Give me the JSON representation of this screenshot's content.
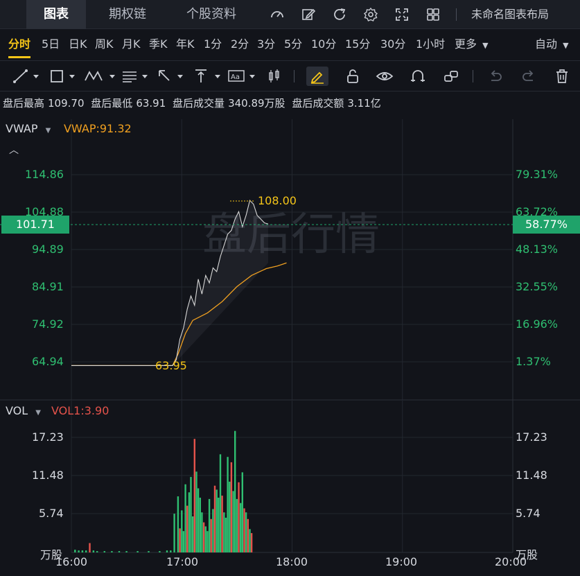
{
  "tabs": [
    "图表",
    "期权链",
    "个股资料"
  ],
  "layout_name": "未命名图表布局",
  "icons": [
    "gauge-icon",
    "edit-icon",
    "refresh-icon",
    "gear-icon",
    "fullscreen-icon",
    "grid-icon"
  ],
  "periods": [
    "分时",
    "5日",
    "日K",
    "周K",
    "月K",
    "季K",
    "年K",
    "1分",
    "2分",
    "3分",
    "5分",
    "10分",
    "15分",
    "30分",
    "1小时",
    "更多"
  ],
  "auto_label": "自动",
  "info": [
    {
      "label": "盘后最高",
      "value": "109.70"
    },
    {
      "label": "盘后最低",
      "value": "63.91"
    },
    {
      "label": "盘后成交量",
      "value": "340.89万股"
    },
    {
      "label": "盘后成交额",
      "value": "3.11亿"
    }
  ],
  "price_panel": {
    "indicator": "VWAP",
    "indicator_value": "VWAP:91.32",
    "watermark": "盘后行情",
    "y_left": [
      "114.86",
      "104.88",
      "94.89",
      "84.91",
      "74.92",
      "64.94"
    ],
    "y_right": [
      "79.31%",
      "63.72%",
      "48.13%",
      "32.55%",
      "16.96%",
      "1.37%"
    ],
    "current_price": "101.71",
    "current_pct": "58.77%",
    "high_label": "108.00",
    "low_label": "63.95"
  },
  "vol_panel": {
    "indicator": "VOL",
    "indicator_value": "VOL1:3.90",
    "y_left": [
      "17.23",
      "11.48",
      "5.74",
      "万股"
    ],
    "y_right": [
      "17.23",
      "11.48",
      "5.74",
      "万股"
    ]
  },
  "x_labels": [
    "16:00",
    "17:00",
    "18:00",
    "19:00",
    "20:00"
  ],
  "colors": {
    "up": "#2fbf71",
    "down": "#e5534b",
    "vwap": "#f0a020",
    "price": "#d8d8d8",
    "accent": "#f5c518"
  },
  "chart_data": {
    "type": "line",
    "x_range": [
      "16:00",
      "20:00"
    ],
    "ylim": [
      59.95,
      119.85
    ],
    "series": [
      {
        "name": "VWAP",
        "values": [
          [
            0,
            63.95
          ],
          [
            55,
            63.95
          ],
          [
            58,
            67.0
          ],
          [
            62,
            72.5
          ],
          [
            66,
            76.0
          ],
          [
            74,
            78.0
          ],
          [
            82,
            81.0
          ],
          [
            90,
            85.0
          ],
          [
            98,
            88.0
          ],
          [
            106,
            89.8
          ],
          [
            112,
            90.5
          ],
          [
            117,
            91.32
          ]
        ]
      },
      {
        "price_values": [
          [
            0,
            63.95
          ],
          [
            55,
            63.95
          ],
          [
            57,
            65.5
          ],
          [
            59,
            71.0
          ],
          [
            61,
            74.0
          ],
          [
            63,
            79.0
          ],
          [
            65,
            82.5
          ],
          [
            67,
            80.0
          ],
          [
            69,
            87.0
          ],
          [
            71,
            83.0
          ],
          [
            73,
            88.0
          ],
          [
            75,
            86.0
          ],
          [
            77,
            90.0
          ],
          [
            79,
            89.0
          ],
          [
            81,
            93.0
          ],
          [
            83,
            96.0
          ],
          [
            85,
            99.0
          ],
          [
            87,
            100.0
          ],
          [
            89,
            103.0
          ],
          [
            91,
            105.0
          ],
          [
            93,
            101.0
          ],
          [
            95,
            104.0
          ],
          [
            97,
            108.0
          ],
          [
            99,
            107.0
          ],
          [
            101,
            104.0
          ],
          [
            103,
            103.0
          ],
          [
            105,
            102.0
          ],
          [
            107,
            101.71
          ]
        ]
      }
    ],
    "volume": [
      [
        2,
        0.4
      ],
      [
        4,
        0.3
      ],
      [
        6,
        0.3
      ],
      [
        8,
        0.3
      ],
      [
        10,
        1.4
      ],
      [
        12,
        0.3
      ],
      [
        14,
        0.2
      ],
      [
        18,
        0.2
      ],
      [
        22,
        0.2
      ],
      [
        26,
        0.2
      ],
      [
        30,
        0.2
      ],
      [
        36,
        0.2
      ],
      [
        42,
        0.2
      ],
      [
        48,
        0.2
      ],
      [
        52,
        0.3
      ],
      [
        54,
        0.3
      ],
      [
        56,
        5.8
      ],
      [
        58,
        8.4
      ],
      [
        59,
        3.6
      ],
      [
        60,
        6.3
      ],
      [
        61,
        3.2
      ],
      [
        62,
        10.2
      ],
      [
        63,
        7.0
      ],
      [
        64,
        9.0
      ],
      [
        65,
        11.3
      ],
      [
        66,
        5.4
      ],
      [
        67,
        17.0
      ],
      [
        68,
        12.1
      ],
      [
        69,
        9.6
      ],
      [
        70,
        8.2
      ],
      [
        71,
        6.0
      ],
      [
        72,
        4.5
      ],
      [
        73,
        3.9
      ],
      [
        74,
        3.2
      ],
      [
        75,
        8.0
      ],
      [
        76,
        5.0
      ],
      [
        77,
        6.5
      ],
      [
        78,
        10.0
      ],
      [
        79,
        9.4
      ],
      [
        80,
        8.2
      ],
      [
        81,
        14.7
      ],
      [
        82,
        8.5
      ],
      [
        83,
        6.0
      ],
      [
        84,
        5.2
      ],
      [
        85,
        14.3
      ],
      [
        86,
        10.6
      ],
      [
        87,
        13.5
      ],
      [
        88,
        9.2
      ],
      [
        89,
        18.2
      ],
      [
        90,
        8.0
      ],
      [
        91,
        10.5
      ],
      [
        92,
        7.4
      ],
      [
        93,
        12.0
      ],
      [
        94,
        6.6
      ],
      [
        95,
        6.0
      ],
      [
        96,
        5.0
      ],
      [
        97,
        3.5
      ],
      [
        98,
        2.9
      ]
    ],
    "volume_up_flags": [
      1,
      1,
      1,
      1,
      0,
      1,
      1,
      1,
      1,
      1,
      1,
      1,
      1,
      1,
      1,
      1,
      1,
      1,
      0,
      1,
      1,
      1,
      0,
      1,
      1,
      1,
      0,
      1,
      1,
      1,
      1,
      0,
      1,
      1,
      1,
      0,
      1,
      0,
      1,
      1,
      1,
      0,
      1,
      1,
      1,
      1,
      0,
      1,
      1,
      1,
      0,
      1,
      1,
      0,
      1,
      0,
      1,
      0,
      0
    ]
  }
}
